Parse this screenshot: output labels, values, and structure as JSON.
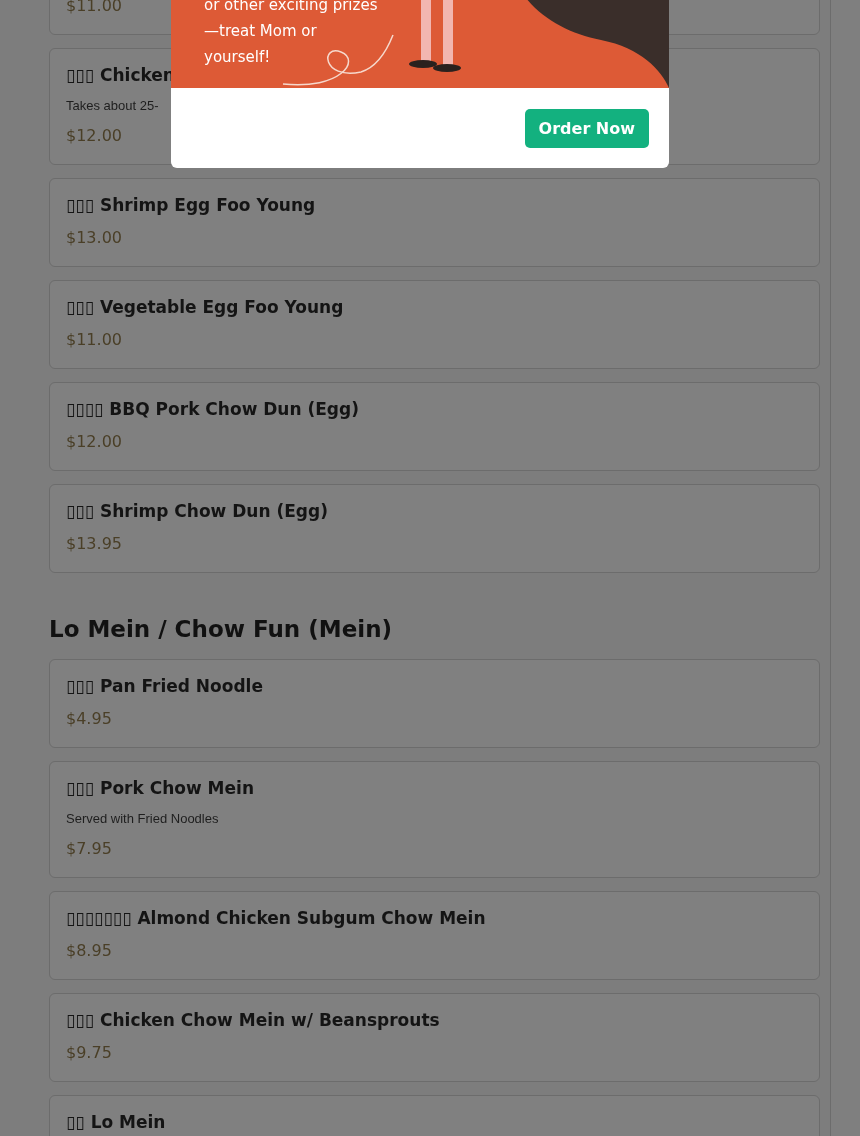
{
  "modal": {
    "banner_lines": [
      "or other exciting prizes",
      "—treat Mom or",
      "yourself!"
    ],
    "button": "Order Now"
  },
  "sections": [
    {
      "items": [
        {
          "price": "$11.00"
        },
        {
          "name": "▯▯▯ Chicken",
          "description": "Takes about 25-",
          "price": "$12.00"
        },
        {
          "name": "▯▯▯ Shrimp Egg Foo Young",
          "price": "$13.00"
        },
        {
          "name": "▯▯▯ Vegetable Egg Foo Young",
          "price": "$11.00"
        },
        {
          "name": "▯▯▯▯ BBQ Pork Chow Dun (Egg)",
          "price": "$12.00"
        },
        {
          "name": "▯▯▯ Shrimp Chow Dun (Egg)",
          "price": "$13.95"
        }
      ]
    },
    {
      "title": "Lo Mein / Chow Fun (Mein)",
      "items": [
        {
          "name": "▯▯▯ Pan Fried Noodle",
          "price": "$4.95"
        },
        {
          "name": "▯▯▯ Pork Chow Mein",
          "description": "Served with Fried Noodles",
          "price": "$7.95"
        },
        {
          "name": "▯▯▯▯▯▯▯ Almond Chicken Subgum Chow Mein",
          "price": "$8.95"
        },
        {
          "name": "▯▯▯ Chicken Chow Mein w/ Beansprouts",
          "price": "$9.75"
        },
        {
          "name": "▯▯ Lo Mein"
        }
      ]
    }
  ]
}
